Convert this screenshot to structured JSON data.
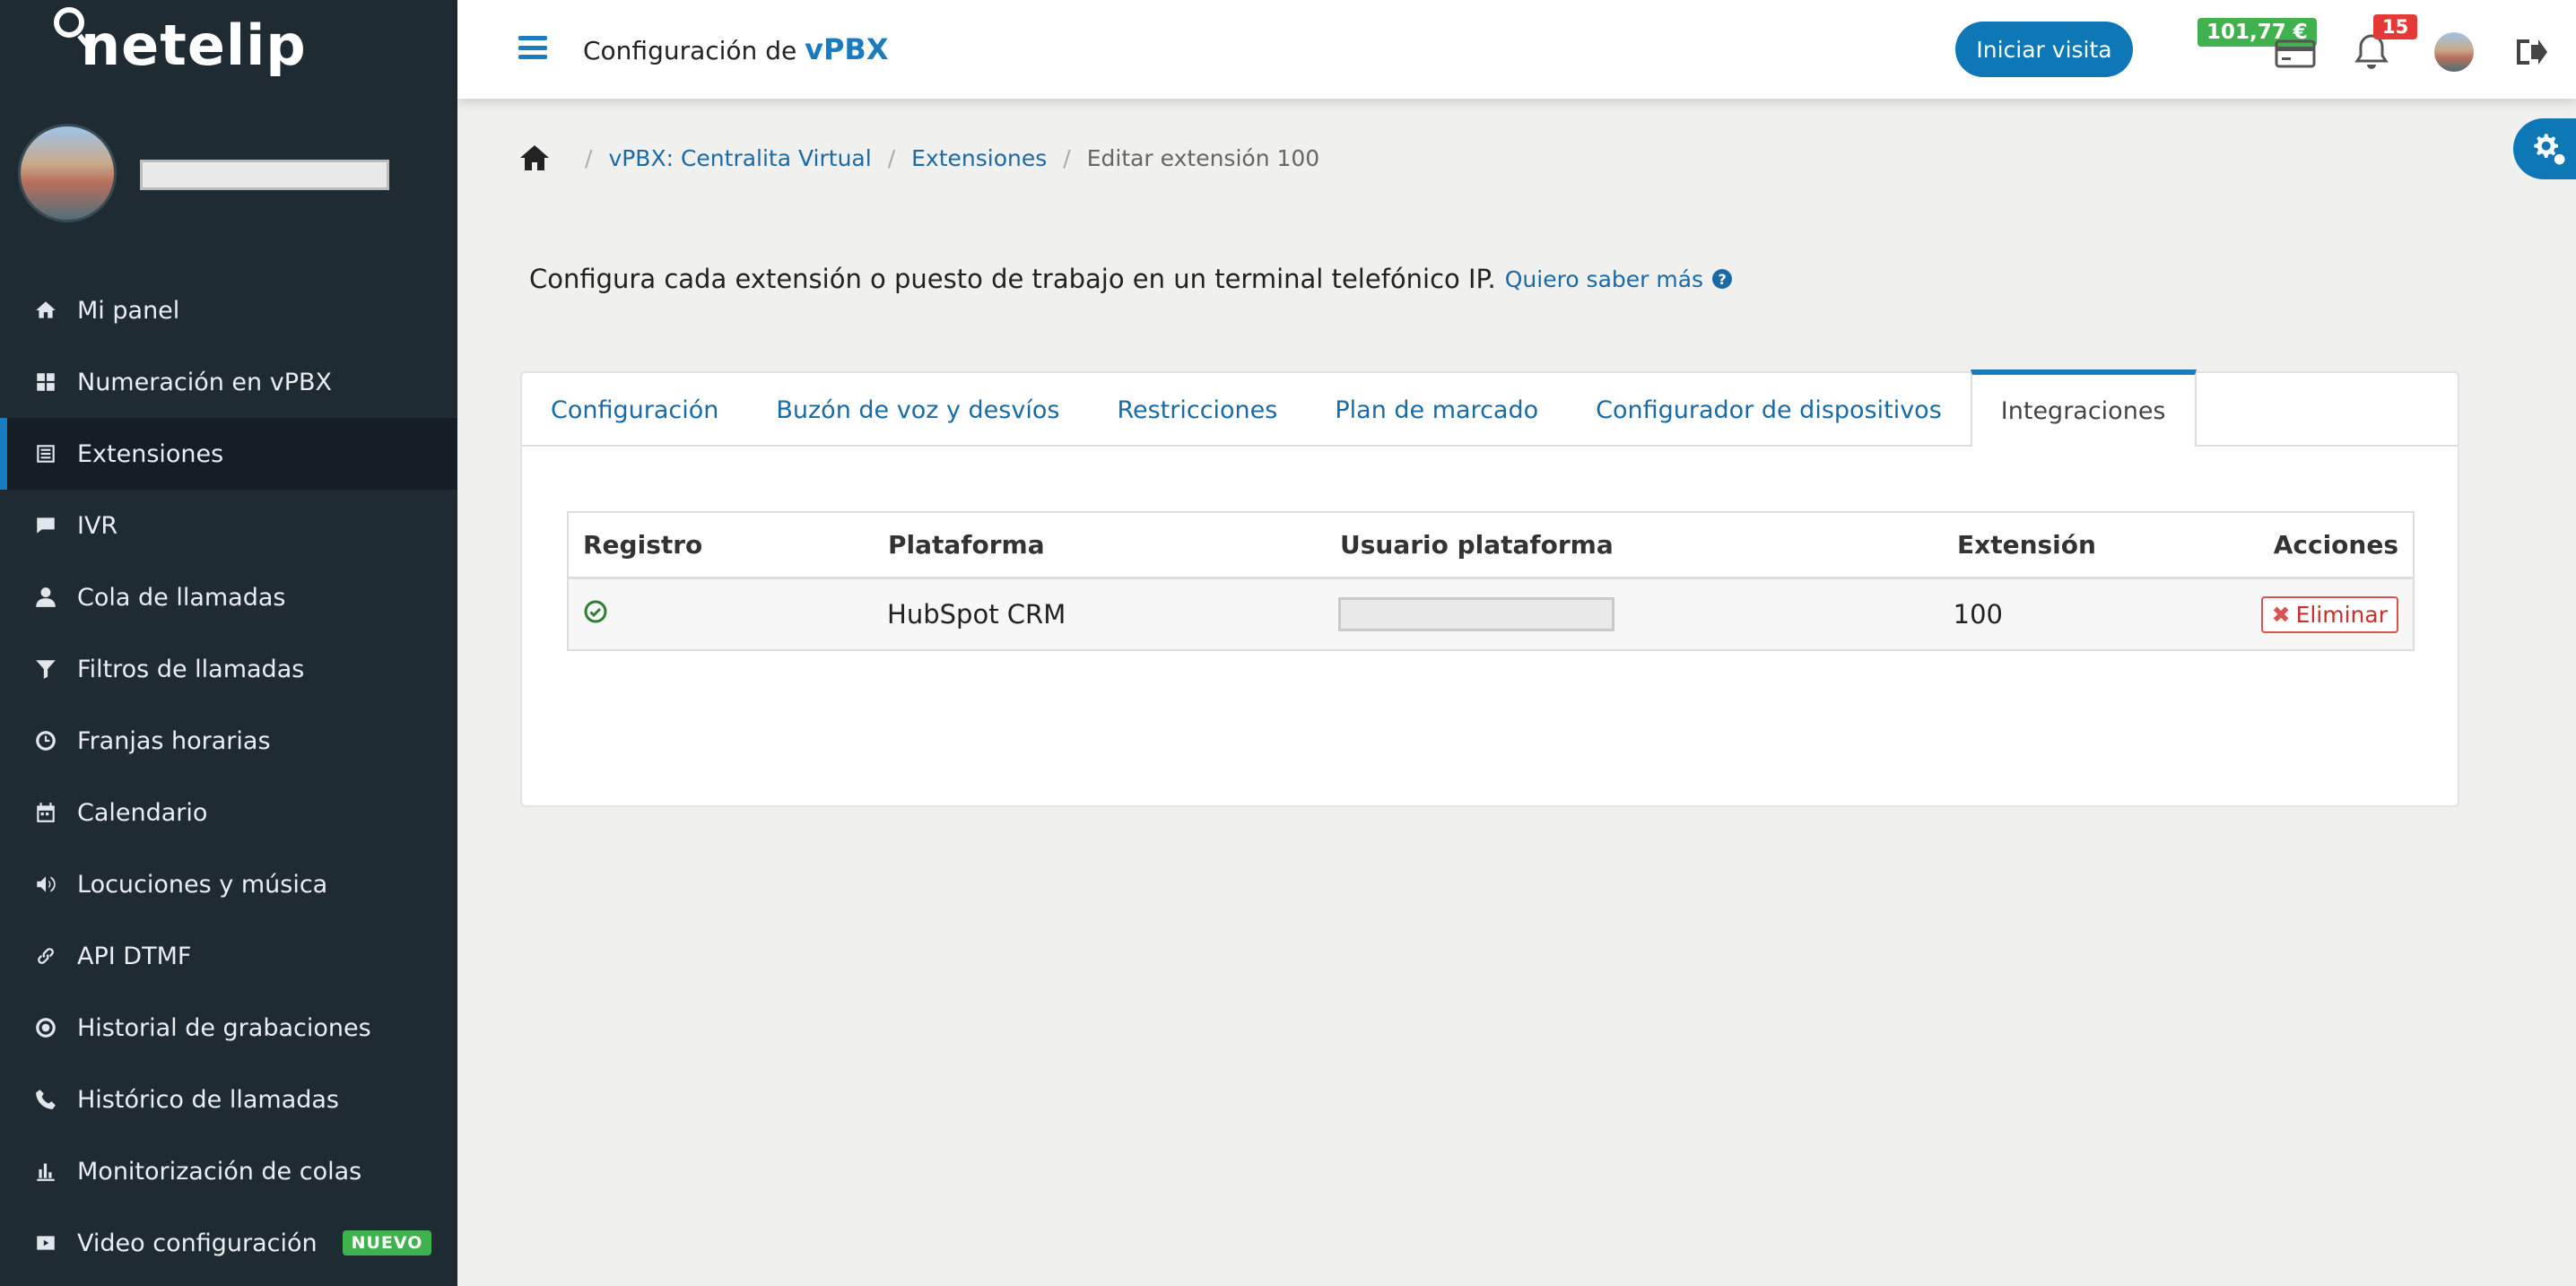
{
  "brand": {
    "logo_text": "netelip"
  },
  "sidebar": {
    "items": [
      {
        "label": "Mi panel",
        "icon": "home-icon"
      },
      {
        "label": "Numeración en vPBX",
        "icon": "grid-icon"
      },
      {
        "label": "Extensiones",
        "icon": "list-icon",
        "active": true
      },
      {
        "label": "IVR",
        "icon": "chat-icon"
      },
      {
        "label": "Cola de llamadas",
        "icon": "user-icon"
      },
      {
        "label": "Filtros de llamadas",
        "icon": "filter-icon"
      },
      {
        "label": "Franjas horarias",
        "icon": "clock-icon"
      },
      {
        "label": "Calendario",
        "icon": "calendar-icon"
      },
      {
        "label": "Locuciones y música",
        "icon": "volume-icon"
      },
      {
        "label": "API DTMF",
        "icon": "link-icon"
      },
      {
        "label": "Historial de grabaciones",
        "icon": "record-icon"
      },
      {
        "label": "Histórico de llamadas",
        "icon": "phone-icon"
      },
      {
        "label": "Monitorización de colas",
        "icon": "bar-chart-icon"
      },
      {
        "label": "Video configuración",
        "icon": "video-icon",
        "badge": "NUEVO"
      }
    ]
  },
  "header": {
    "title_prefix": "Configuración de ",
    "title_strong": "vPBX",
    "visit_button": "Iniciar visita",
    "balance": "101,77 €",
    "notifications": "15"
  },
  "breadcrumb": {
    "items": [
      "vPBX: Centralita Virtual",
      "Extensiones"
    ],
    "current": "Editar extensión 100"
  },
  "intro": {
    "text": "Configura cada extensión o puesto de trabajo en un terminal telefónico IP.",
    "link": "Quiero saber más"
  },
  "tabs": [
    {
      "label": "Configuración"
    },
    {
      "label": "Buzón de voz y desvíos"
    },
    {
      "label": "Restricciones"
    },
    {
      "label": "Plan de marcado"
    },
    {
      "label": "Configurador de dispositivos"
    },
    {
      "label": "Integraciones",
      "active": true
    }
  ],
  "table": {
    "headers": [
      "Registro",
      "Plataforma",
      "Usuario plataforma",
      "Extensión",
      "Acciones"
    ],
    "rows": [
      {
        "platform": "HubSpot CRM",
        "extension": "100",
        "action": "Eliminar"
      }
    ]
  },
  "colors": {
    "sidebar_bg": "#1e2b33",
    "accent": "#1a7bbf",
    "success": "#3fb24d",
    "danger": "#d9534f"
  }
}
